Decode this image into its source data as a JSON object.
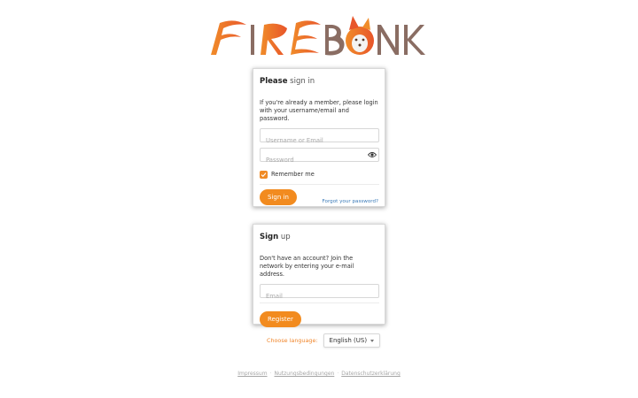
{
  "brand": {
    "logo_text": "FIREBONK",
    "accent": "#f28b1f",
    "logo_fire_colors": [
      "#f08c2a",
      "#e8552a"
    ],
    "logo_letter_color": "#8a6d63"
  },
  "signin": {
    "title_strong": "Please",
    "title_light": "sign in",
    "description": "If you're already a member, please login with your username/email and password.",
    "username_placeholder": "Username or Email",
    "password_placeholder": "Password",
    "remember_label": "Remember me",
    "remember_checked": true,
    "submit_label": "Sign in",
    "forgot_label": "Forgot your password?"
  },
  "signup": {
    "title_strong": "Sign",
    "title_light": "up",
    "description": "Don't have an account? Join the network by entering your e-mail address.",
    "email_placeholder": "Email",
    "submit_label": "Register"
  },
  "language": {
    "label": "Choose language:",
    "selected": "English (US)"
  },
  "footer": {
    "links": [
      "Impressum",
      "Nutzungsbedingungen",
      "Datenschutzerklärung"
    ],
    "separator": "·"
  }
}
